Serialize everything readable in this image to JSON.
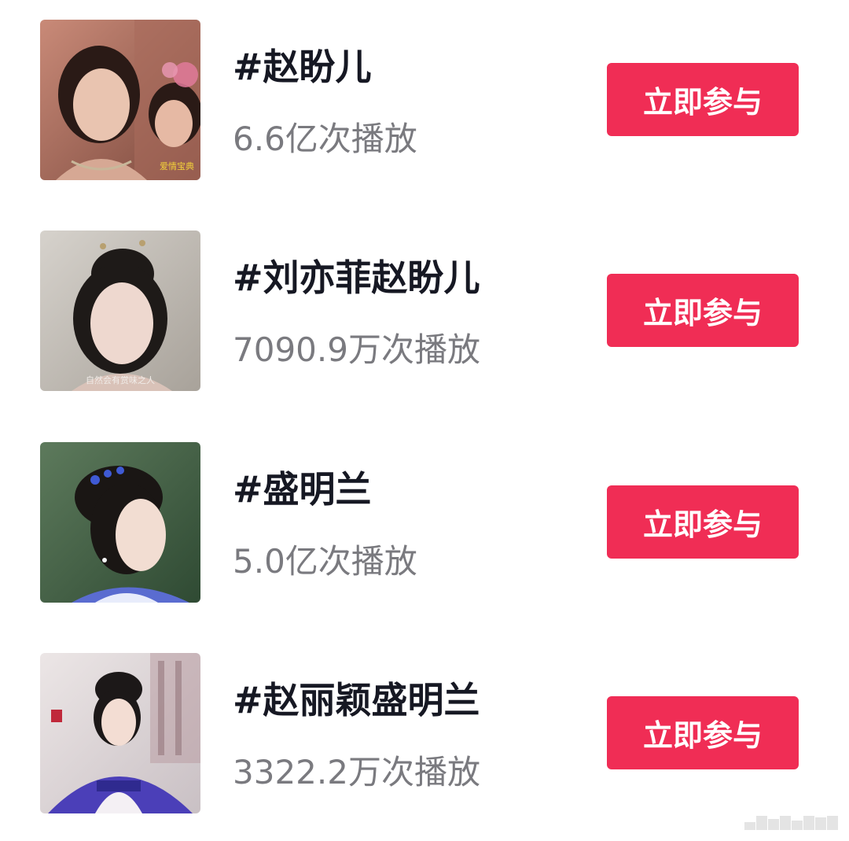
{
  "topics": [
    {
      "title": "#赵盼儿",
      "plays": "6.6亿次播放",
      "button_label": "立即参与",
      "thumb_caption": "爱情宝典",
      "thumb_colors": {
        "bg": "#c98a78",
        "bg2": "#7d4a3e",
        "skin": "#e9c4b0",
        "hair": "#2a1a16",
        "accent": "#e07a9a"
      }
    },
    {
      "title": "#刘亦菲赵盼儿",
      "plays": "7090.9万次播放",
      "button_label": "立即参与",
      "thumb_caption": "自然会有赏味之人",
      "thumb_colors": {
        "bg": "#d6d2cc",
        "bg2": "#a8a29a",
        "skin": "#eed8cf",
        "hair": "#1e1a18",
        "accent": "#b8a070"
      }
    },
    {
      "title": "#盛明兰",
      "plays": "5.0亿次播放",
      "button_label": "立即参与",
      "thumb_caption": "",
      "thumb_colors": {
        "bg": "#5d7a5c",
        "bg2": "#2f4a33",
        "skin": "#f2ddd2",
        "hair": "#1a1614",
        "accent": "#5a6cd0"
      }
    },
    {
      "title": "#赵丽颖盛明兰",
      "plays": "3322.2万次播放",
      "button_label": "立即参与",
      "thumb_caption": "",
      "thumb_colors": {
        "bg": "#ece6e6",
        "bg2": "#c9c0c4",
        "skin": "#f3ddd3",
        "hair": "#1c1818",
        "accent": "#4b3fb8"
      }
    }
  ]
}
